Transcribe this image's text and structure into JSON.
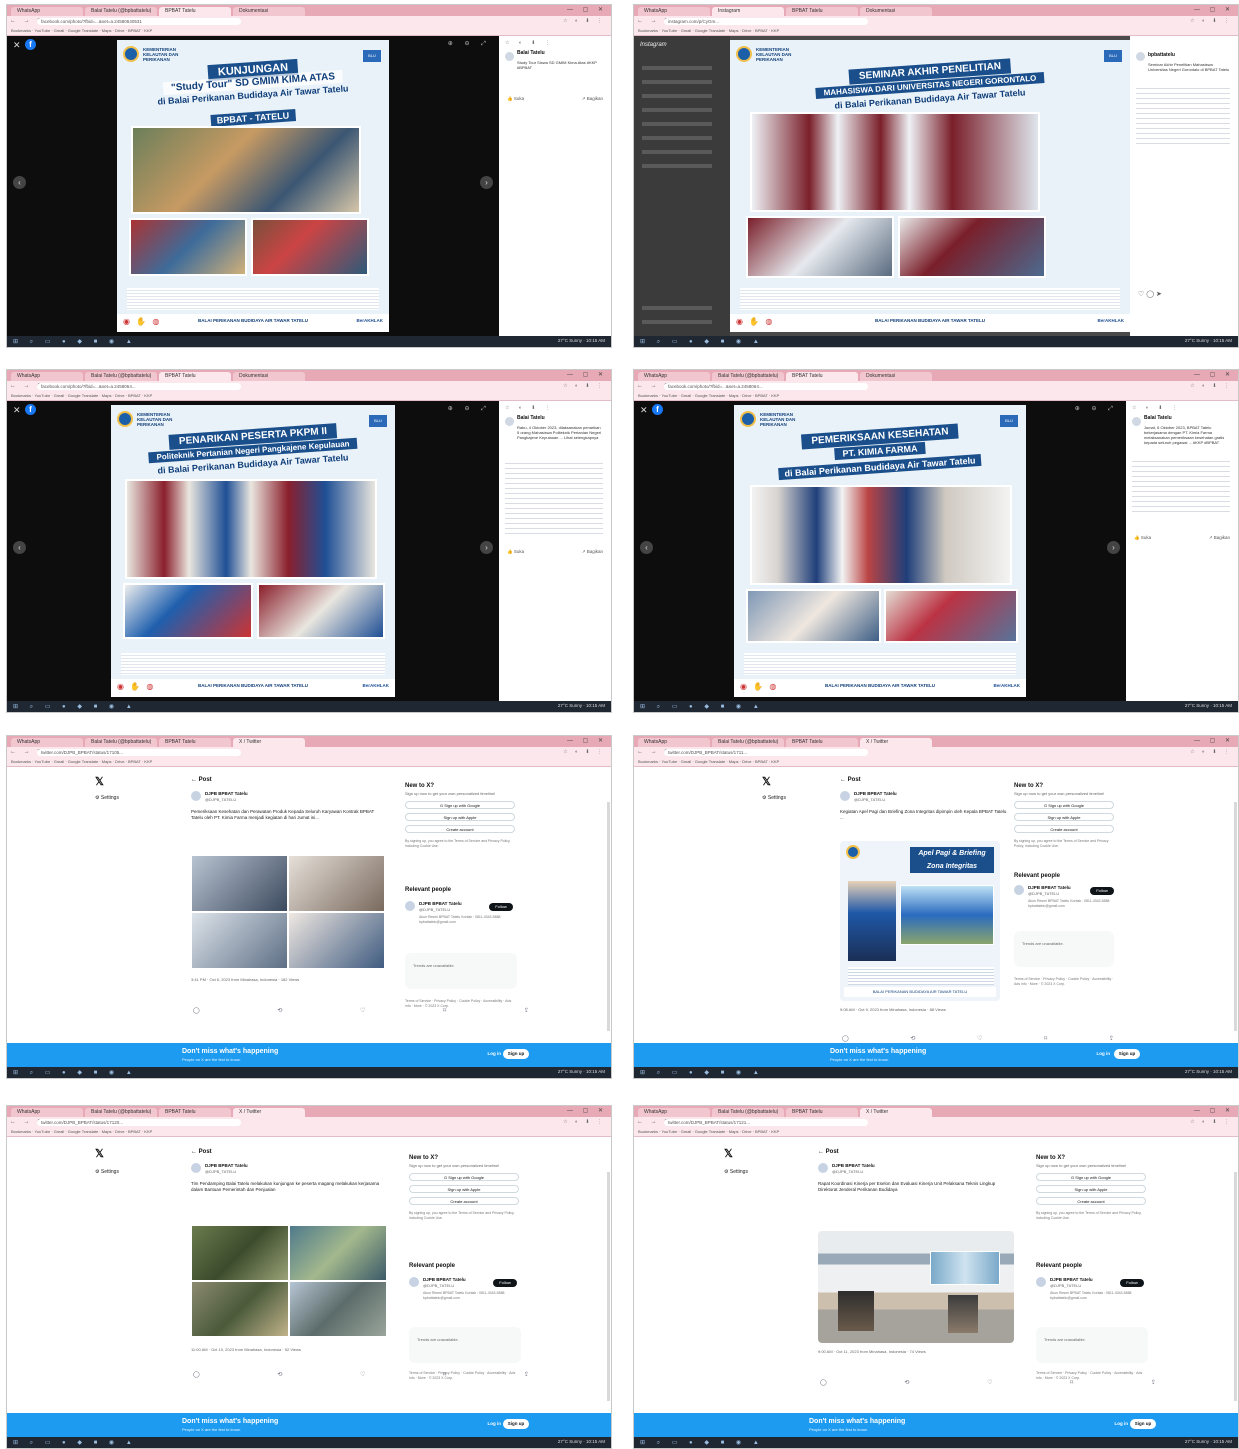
{
  "common": {
    "tab_labels": [
      "WhatsApp",
      "Balai Tatelu (@bpbattatelu)",
      "BPBAT Tatelu",
      "Dokumentasi",
      "Instagram",
      "X / Twitter"
    ],
    "nav_icons": "← → ⟳ ⌂",
    "ext_icons": "☆ ◐ ⬇ ⋮",
    "win_controls": "— ▢ ✕",
    "bookmarks": "Bookmarks  ·  YouTube  ·  Gmail  ·  Google Translate  ·  Maps  ·  Drive  ·  BPBAT  ·  KKP",
    "taskbar_icons": "⊞ ⌕ ▭ ● ◆ ■ ◉ ▲",
    "taskbar_time": "27°C Sunny  ·  10:15 AM",
    "fb_icon": "f",
    "close": "✕",
    "zoom_icons": "⊕ ⊖ ⤢",
    "prev": "‹",
    "next": "›",
    "org": "KEMENTERIAN KELAUTAN DAN PERIKANAN",
    "blu_badge": "BLU",
    "footer_logos": "◉ ✋ ◍",
    "footer_text": "BALAI PERIKANAN BUDIDAYA AIR TAWAR TATELU",
    "footer_right": "BerAKHLAK",
    "icon_colors": {
      "facebook": "#1877f2",
      "twitter_blue": "#1d9bf0"
    }
  },
  "shot1": {
    "url": "facebook.com/photo/?fbid=...&set=a.24580640531",
    "banner": "KUNJUNGAN",
    "sub": "\"Study Tour\" SD GMIM KIMA ATAS",
    "sub2": "di Balai Perikanan Budidaya Air Tawar Tatelu",
    "sub3": "BPBAT - TATELU",
    "side_author": "Balai Tatelu",
    "side_text": "Study Tour Siswa SD GMIM Kima Atas #KKP #BPBAT",
    "like": "👍 Suka",
    "share": "↗ Bagikan"
  },
  "shot2": {
    "url": "instagram.com/p/CyGm...",
    "brand": "Instagram",
    "banner": "SEMINAR AKHIR PENELITIAN",
    "sub": "MAHASISWA DARI UNIVERSITAS NEGERI GORONTALO",
    "sub2": "di Balai Perikanan Budidaya Air Tawar Tatelu",
    "side_author": "bpbattatelu",
    "side_text": "Seminar Akhir Penelitian Mahasiswa Universitas Negeri Gorontalo di BPBAT Tatelu",
    "like_row": "♡ ◯ ➤"
  },
  "shot3": {
    "url": "facebook.com/photo/?fbid=...&set=a.2458064...",
    "banner": "PENARIKAN PESERTA PKPM II",
    "sub": "Politeknik Pertanian Negeri Pangkajene Kepulauan",
    "sub2": "di Balai Perikanan Budidaya Air Tawar Tatelu",
    "side_author": "Balai Tatelu",
    "side_text": "Rabu, 4 Oktober 2023, dilaksanakan penarikan 5 orang Mahasiswa Politeknik Pertanian Negeri Pangkajene Kepulauan ... Lihat selengkapnya",
    "like": "👍 Suka",
    "share": "↗ Bagikan"
  },
  "shot4": {
    "url": "facebook.com/photo/?fbid=...&set=a.2458064...",
    "banner": "PEMERIKSAAN KESEHATAN",
    "sub": "PT. KIMIA FARMA",
    "sub2": "di Balai Perikanan Budidaya Air Tawar Tatelu",
    "side_author": "Balai Tatelu",
    "side_text": "Jumat, 6 Oktober 2023, BPBAT Tatelu bekerjasama dengan PT. Kimia Farma melaksanakan pemeriksaan kesehatan gratis kepada seluruh pegawai ... #KKP #BPBAT",
    "like": "👍 Suka",
    "share": "↗ Bagikan"
  },
  "shot5": {
    "url": "twitter.com/DJPB_BPBAT/status/17105...",
    "x": "𝕏",
    "settings": "⚙ Settings",
    "post": "← Post",
    "handle": "DJPB BPBAT Tatelu",
    "at": "@DJPB_TATELU",
    "text": "Pemeriksaan Kesehatan dan Perawatan Produk Kepada Seluruh Karyawan Kontrak BPBAT Tatelu oleh PT. Kimia Farma menjadi kegiatan di hari Jumat ini...",
    "meta": "3:41 PM · Oct 6, 2023 from Minahasa, Indonesia · 182 Views",
    "acts": "◯ ⟲ ♡ ⌑ ⇪",
    "newto": "New to X?",
    "newto_sub": "Sign up now to get your own personalized timeline!",
    "google": "G  Sign up with Google",
    "apple": " Sign up with Apple",
    "create": "Create account",
    "terms": "By signing up, you agree to the Terms of Service and Privacy Policy, including Cookie Use.",
    "relevant": "Relevant people",
    "rp_name": "DJPB BPBAT Tatelu",
    "rp_at": "@DJPB_TATELU",
    "rp_bio": "Akun Resmi BPBAT Tatelu Kontak : 0811-4343-5888 bpbattatelu@gmail.com",
    "follow": "Follow",
    "trends": "Trends are unavailable.",
    "foot": "Terms of Service · Privacy Policy · Cookie Policy · Accessibility · Ads info · More · © 2023 X Corp.",
    "banner_title": "Don't miss what's happening",
    "banner_sub": "People on X are the first to know.",
    "login": "Log in",
    "signup": "Sign up"
  },
  "shot6": {
    "url": "twitter.com/DJPB_BPBAT/status/1711...",
    "x": "𝕏",
    "settings": "⚙ Settings",
    "post": "← Post",
    "handle": "DJPB BPBAT Tatelu",
    "at": "@DJPB_TATELU",
    "text": "Kegiatan Apel Pagi dan Briefing Zona Integritas dipimpin oleh Kepala BPBAT Tatelu ...",
    "poster_title": "Apel Pagi & Briefing Zona Integritas",
    "meta": "9:08 AM · Oct 9, 2023 from Minahasa, Indonesia · 88 Views",
    "acts": "◯ ⟲ ♡ ⌑ ⇪",
    "newto": "New to X?",
    "newto_sub": "Sign up now to get your own personalized timeline!",
    "google": "G  Sign up with Google",
    "apple": " Sign up with Apple",
    "create": "Create account",
    "terms": "By signing up, you agree to the Terms of Service and Privacy Policy, including Cookie Use.",
    "relevant": "Relevant people",
    "rp_name": "DJPB BPBAT Tatelu",
    "rp_at": "@DJPB_TATELU",
    "rp_bio": "Akun Resmi BPBAT Tatelu Kontak : 0811-4343-5888 bpbattatelu@gmail.com",
    "follow": "Follow",
    "trends": "Trends are unavailable.",
    "foot": "Terms of Service · Privacy Policy · Cookie Policy · Accessibility · Ads info · More · © 2023 X Corp.",
    "banner_title": "Don't miss what's happening",
    "banner_sub": "People on X are the first to know.",
    "login": "Log in",
    "signup": "Sign up"
  },
  "shot7": {
    "url": "twitter.com/DJPB_BPBAT/status/17120...",
    "x": "𝕏",
    "settings": "⚙ Settings",
    "post": "← Post",
    "handle": "DJPB BPBAT Tatelu",
    "at": "@DJPB_TATELU",
    "text": "Tim Pendamping Balai Tatelu melakukan kunjungan ke peserta magang melakukan kerjasama dalam Bantuan Pemerintah dan Penjualan",
    "meta": "11:00 AM · Oct 10, 2023 from Minahasa, Indonesia · 52 Views",
    "acts": "◯ ⟲ ♡ ⌑ ⇪",
    "newto": "New to X?",
    "newto_sub": "Sign up now to get your own personalized timeline!",
    "google": "G  Sign up with Google",
    "apple": " Sign up with Apple",
    "create": "Create account",
    "terms": "By signing up, you agree to the Terms of Service and Privacy Policy, including Cookie Use.",
    "relevant": "Relevant people",
    "rp_name": "DJPB BPBAT Tatelu",
    "rp_at": "@DJPB_TATELU",
    "rp_bio": "Akun Resmi BPBAT Tatelu Kontak : 0811-4343-5888 bpbattatelu@gmail.com",
    "follow": "Follow",
    "trends": "Trends are unavailable.",
    "foot": "Terms of Service · Privacy Policy · Cookie Policy · Accessibility · Ads info · More · © 2023 X Corp.",
    "banner_title": "Don't miss what's happening",
    "banner_sub": "People on X are the first to know.",
    "login": "Log in",
    "signup": "Sign up"
  },
  "shot8": {
    "url": "twitter.com/DJPB_BPBAT/status/17121...",
    "x": "𝕏",
    "settings": "⚙ Settings",
    "post": "← Post",
    "handle": "DJPB BPBAT Tatelu",
    "at": "@DJPB_TATELU",
    "text": "Rapat Koordinasi Kinerja per Eselon dan Evaluasi Kinerja Unit Pelaksana Teknis Lingkup Direktorat Jenderal Perikanan Budidaya",
    "meta": "9:00 AM · Oct 11, 2023 from Minahasa, Indonesia · 74 Views",
    "acts": "◯ ⟲ ♡ ⌑ ⇪",
    "newto": "New to X?",
    "newto_sub": "Sign up now to get your own personalized timeline!",
    "google": "G  Sign up with Google",
    "apple": " Sign up with Apple",
    "create": "Create account",
    "terms": "By signing up, you agree to the Terms of Service and Privacy Policy, including Cookie Use.",
    "relevant": "Relevant people",
    "rp_name": "DJPB BPBAT Tatelu",
    "rp_at": "@DJPB_TATELU",
    "rp_bio": "Akun Resmi BPBAT Tatelu Kontak : 0811-4343-5888 bpbattatelu@gmail.com",
    "follow": "Follow",
    "trends": "Trends are unavailable.",
    "foot": "Terms of Service · Privacy Policy · Cookie Policy · Accessibility · Ads info · More · © 2023 X Corp.",
    "banner_title": "Don't miss what's happening",
    "banner_sub": "People on X are the first to know.",
    "login": "Log in",
    "signup": "Sign up"
  }
}
